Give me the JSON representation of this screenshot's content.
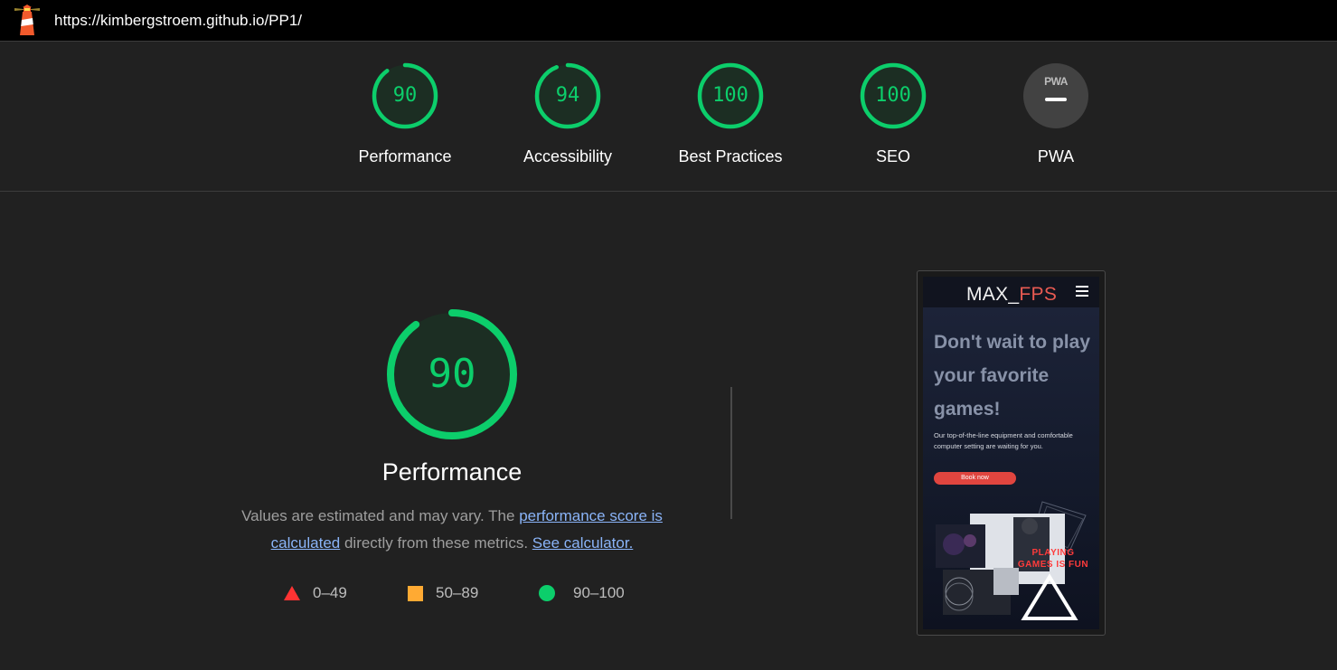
{
  "header": {
    "logo_icon": "lighthouse-icon",
    "url": "https://kimbergstroem.github.io/PP1/"
  },
  "categories": [
    {
      "label": "Performance",
      "score": 90,
      "score_text": "90",
      "color": "#0cce6b"
    },
    {
      "label": "Accessibility",
      "score": 94,
      "score_text": "94",
      "color": "#0cce6b"
    },
    {
      "label": "Best Practices",
      "score": 100,
      "score_text": "100",
      "color": "#0cce6b"
    },
    {
      "label": "SEO",
      "score": 100,
      "score_text": "100",
      "color": "#0cce6b"
    },
    {
      "label": "PWA",
      "badge_text": "PWA",
      "icon": "pwa-badge-icon"
    }
  ],
  "performance": {
    "score": 90,
    "score_text": "90",
    "title": "Performance",
    "desc_part1": "Values are estimated and may vary. The ",
    "desc_link1": "performance score is calculated",
    "desc_part2": " directly from these metrics. ",
    "desc_link2": "See calculator."
  },
  "legend": [
    {
      "range": "0–49",
      "icon": "fail-triangle-icon",
      "color": "#ff3333"
    },
    {
      "range": "50–89",
      "icon": "average-square-icon",
      "color": "#ffaa33"
    },
    {
      "range": "90–100",
      "icon": "pass-circle-icon",
      "color": "#0cce6b"
    }
  ],
  "screenshot": {
    "brand_prefix": "MAX_",
    "brand_suffix": "FPS",
    "menu_icon": "hamburger-menu-icon",
    "headline": "Don't wait to play your favorite games!",
    "subtext": "Our top-of-the-line equipment and comfortable computer setting are waiting for you.",
    "button": "Book now",
    "art_text": "PLAYING GAMES IS FUN"
  },
  "colors": {
    "pass": "#0cce6b",
    "background": "#212121",
    "link": "#8ab4f8"
  }
}
